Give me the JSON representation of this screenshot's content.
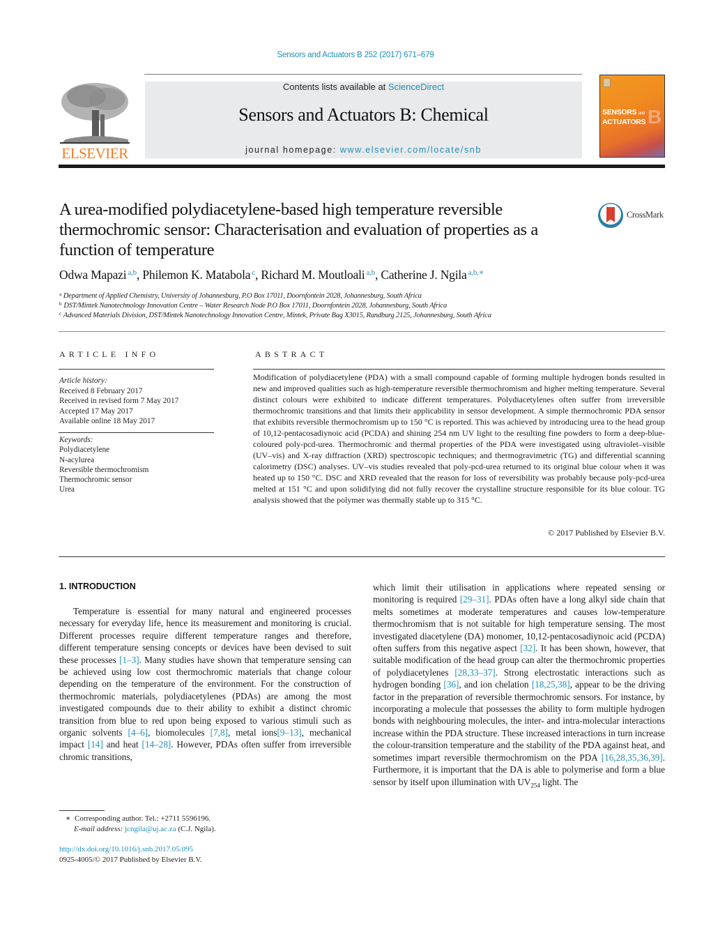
{
  "header": {
    "journal_ref": "Sensors and Actuators B 252 (2017) 671–679",
    "contents_prefix": "Contents lists available at ",
    "contents_link": "ScienceDirect",
    "journal_title": "Sensors and Actuators B: Chemical",
    "homepage_prefix": "journal homepage: ",
    "homepage_link": "www.elsevier.com/locate/snb",
    "publisher_logo_text": "ELSEVIER",
    "cover": {
      "line1": "SENSORS",
      "line1_small": "and",
      "line2": "ACTUATORS",
      "letter": "B"
    },
    "colors": {
      "link": "#1f8fb5",
      "elsevier_orange": "#f07b22",
      "banner_bg": "#e9eaeb"
    }
  },
  "article": {
    "title": "A urea-modified polydiacetylene-based high temperature reversible thermochromic sensor: Characterisation and evaluation of properties as a function of temperature",
    "crossmark_label": "CrossMark",
    "authors": [
      {
        "name": "Odwa Mapazi",
        "affil": "a,b",
        "sep": ", "
      },
      {
        "name": "Philemon K. Matabola",
        "affil": "c",
        "sep": ", "
      },
      {
        "name": "Richard M. Moutloali",
        "affil": "a,b",
        "sep": ", "
      },
      {
        "name": "Catherine J. Ngila",
        "affil": "a,b,∗",
        "sep": ""
      }
    ],
    "affiliations": [
      {
        "key": "a",
        "text": "Department of Applied Chemistry, University of Johannesburg, P.O Box 17011, Doornfontein 2028, Johannesburg, South Africa"
      },
      {
        "key": "b",
        "text": "DST/Mintek Nanotechnology Innovation Centre – Water Research Node P.O Box 17011, Doornfontein 2028, Johannesburg, South Africa"
      },
      {
        "key": "c",
        "text": "Advanced Materials Division, DST/Mintek Nanotechnology Innovation Centre, Mintek, Private Bag X3015, Randburg 2125, Johannesburg, South Africa"
      }
    ]
  },
  "article_info": {
    "heading": "ARTICLE INFO",
    "history_label": "Article history:",
    "history": [
      "Received 8 February 2017",
      "Received in revised form 7 May 2017",
      "Accepted 17 May 2017",
      "Available online 18 May 2017"
    ],
    "keywords_label": "Keywords:",
    "keywords": [
      "Polydiacetylene",
      "N-acylurea",
      "Reversible thermochromism",
      "Thermochromic sensor",
      "Urea"
    ]
  },
  "abstract": {
    "heading": "ABSTRACT",
    "text": "Modification of polydiacetylene (PDA) with a small compound capable of forming multiple hydrogen bonds resulted in new and improved qualities such as high-temperature reversible thermochromism and higher melting temperature. Several distinct colours were exhibited to indicate different temperatures. Polydiacetylenes often suffer from irreversible thermochromic transitions and that limits their applicability in sensor development. A simple thermochromic PDA sensor that exhibits reversible thermochromism up to 150 °C is reported. This was achieved by introducing urea to the head group of 10,12-pentacosadiynoic acid (PCDA) and shining 254 nm UV light to the resulting fine powders to form a deep-blue-coloured poly-pcd-urea. Thermochromic and thermal properties of the PDA were investigated using ultraviolet–visible (UV–vis) and X-ray diffraction (XRD) spectroscopic techniques; and thermogravimetric (TG) and differential scanning calorimetry (DSC) analyses. UV–vis studies revealed that poly-pcd-urea returned to its original blue colour when it was heated up to 150 °C. DSC and XRD revealed that the reason for loss of reversibility was probably because poly-pcd-urea melted at 151 °C and upon solidifying did not fully recover the crystalline structure responsible for its blue colour. TG analysis showed that the polymer was thermally stable up to 315 °C.",
    "copyright": "© 2017 Published by Elsevier B.V."
  },
  "body": {
    "section_heading": "1.  INTRODUCTION",
    "left_column": [
      {
        "t": "text",
        "v": "Temperature is essential for many natural and engineered processes necessary for everyday life, hence its measurement and monitoring is crucial. Different processes require different temperature ranges and therefore, different temperature sensing concepts or devices have been devised to suit these processes "
      },
      {
        "t": "ref",
        "v": "[1–3]"
      },
      {
        "t": "text",
        "v": ". Many studies have shown that temperature sensing can be achieved using low cost thermochromic materials that change colour depending on the temperature of the environment. For the construction of thermochromic materials, polydiacetylenes (PDAs) are among the most investigated compounds due to their ability to exhibit a distinct chromic transition from blue to red upon being exposed to various stimuli such as organic solvents "
      },
      {
        "t": "ref",
        "v": "[4–6]"
      },
      {
        "t": "text",
        "v": ", biomolecules "
      },
      {
        "t": "ref",
        "v": "[7,8]"
      },
      {
        "t": "text",
        "v": ", metal ions"
      },
      {
        "t": "ref",
        "v": "[9–13]"
      },
      {
        "t": "text",
        "v": ", mechanical impact "
      },
      {
        "t": "ref",
        "v": "[14]"
      },
      {
        "t": "text",
        "v": " and heat "
      },
      {
        "t": "ref",
        "v": "[14–28]"
      },
      {
        "t": "text",
        "v": ". However, PDAs often suffer from irreversible chromic transitions,"
      }
    ],
    "right_column": [
      {
        "t": "text",
        "v": "which limit their utilisation in applications where repeated sensing or monitoring is required "
      },
      {
        "t": "ref",
        "v": "[29–31]"
      },
      {
        "t": "text",
        "v": ". PDAs often have a long alkyl side chain that melts sometimes at moderate temperatures and causes low-temperature thermochromism that is not suitable for high temperature sensing. The most investigated diacetylene (DA) monomer, 10,12-pentacosadiynoic acid (PCDA) often suffers from this negative aspect "
      },
      {
        "t": "ref",
        "v": "[32]"
      },
      {
        "t": "text",
        "v": ". It has been shown, however, that suitable modification of the head group can alter the thermochromic properties of polydiacetylenes "
      },
      {
        "t": "ref",
        "v": "[28,33–37]"
      },
      {
        "t": "text",
        "v": ". Strong electrostatic interactions such as hydrogen bonding "
      },
      {
        "t": "ref",
        "v": "[36]"
      },
      {
        "t": "text",
        "v": ", and ion chelation "
      },
      {
        "t": "ref",
        "v": "[18,25,38]"
      },
      {
        "t": "text",
        "v": ", appear to be the driving factor in the preparation of reversible thermochromic sensors. For instance, by incorporating a molecule that possesses the ability to form multiple hydrogen bonds with neighbouring molecules, the inter- and intra-molecular interactions increase within the PDA structure. These increased interactions in turn increase the colour-transition temperature and the stability of the PDA against heat, and sometimes impart reversible thermochromism on the PDA "
      },
      {
        "t": "ref",
        "v": "[16,28,35,36,39]"
      },
      {
        "t": "text",
        "v": ". Furthermore, it is important that the DA is able to polymerise and form a blue sensor by itself upon illumination with UV"
      },
      {
        "t": "sub",
        "v": "254"
      },
      {
        "t": "text",
        "v": " light. The"
      }
    ]
  },
  "footnote": {
    "mark": "∗",
    "corresponding": "Corresponding author. Tel.: +2711 5596196.",
    "email_label": "E-mail address: ",
    "email": "jcngila@uj.ac.za",
    "email_suffix": " (C.J. Ngila).",
    "doi": "http://dx.doi.org/10.1016/j.snb.2017.05.095",
    "issn_line": "0925-4005/© 2017 Published by Elsevier B.V."
  }
}
